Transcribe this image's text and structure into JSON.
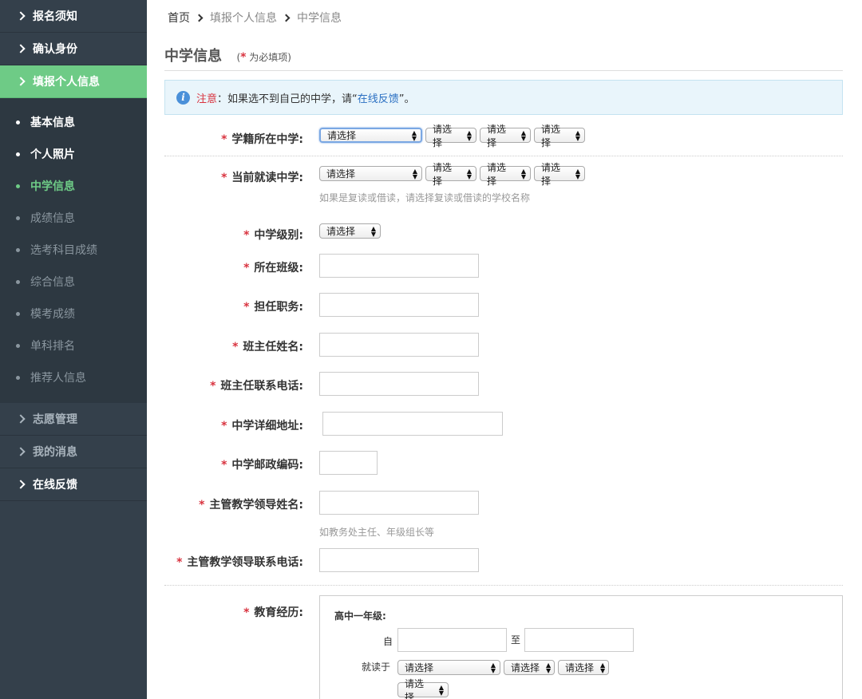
{
  "sidebar": {
    "top_items": [
      {
        "label": "报名须知"
      },
      {
        "label": "确认身份"
      },
      {
        "label": "填报个人信息"
      }
    ],
    "sub_items": [
      {
        "label": "基本信息"
      },
      {
        "label": "个人照片"
      },
      {
        "label": "中学信息"
      },
      {
        "label": "成绩信息"
      },
      {
        "label": "选考科目成绩"
      },
      {
        "label": "综合信息"
      },
      {
        "label": "模考成绩"
      },
      {
        "label": "单科排名"
      },
      {
        "label": "推荐人信息"
      }
    ],
    "bottom_items": [
      {
        "label": "志愿管理"
      },
      {
        "label": "我的消息"
      },
      {
        "label": "在线反馈"
      }
    ]
  },
  "breadcrumb": {
    "home": "首页",
    "level2": "填报个人信息",
    "level3": "中学信息"
  },
  "section": {
    "title": "中学信息",
    "req_open": "(",
    "req_star": "*",
    "req_text": " 为必填项)"
  },
  "notice": {
    "icon": "i",
    "warn": "注意",
    "text1": "：如果选不到自己的中学，请“",
    "link": "在线反馈",
    "text2": "”。"
  },
  "select_placeholder": "请选择",
  "form": {
    "star": "*",
    "school_register": "学籍所在中学:",
    "school_current": "当前就读中学:",
    "school_current_hint": "如果是复读或借读，请选择复读或借读的学校名称",
    "school_level": "中学级别:",
    "class": "所在班级:",
    "position": "担任职务:",
    "teacher_name": "班主任姓名:",
    "teacher_phone": "班主任联系电话:",
    "address": "中学详细地址:",
    "postcode": "中学邮政编码:",
    "leader_name": "主管教学领导姓名:",
    "leader_hint": "如教务处主任、年级组长等",
    "leader_phone": "主管教学领导联系电话:",
    "education": "教育经历:"
  },
  "education": {
    "grade": "高中一年级:",
    "from": "自",
    "to": "至",
    "school": "就读于"
  }
}
